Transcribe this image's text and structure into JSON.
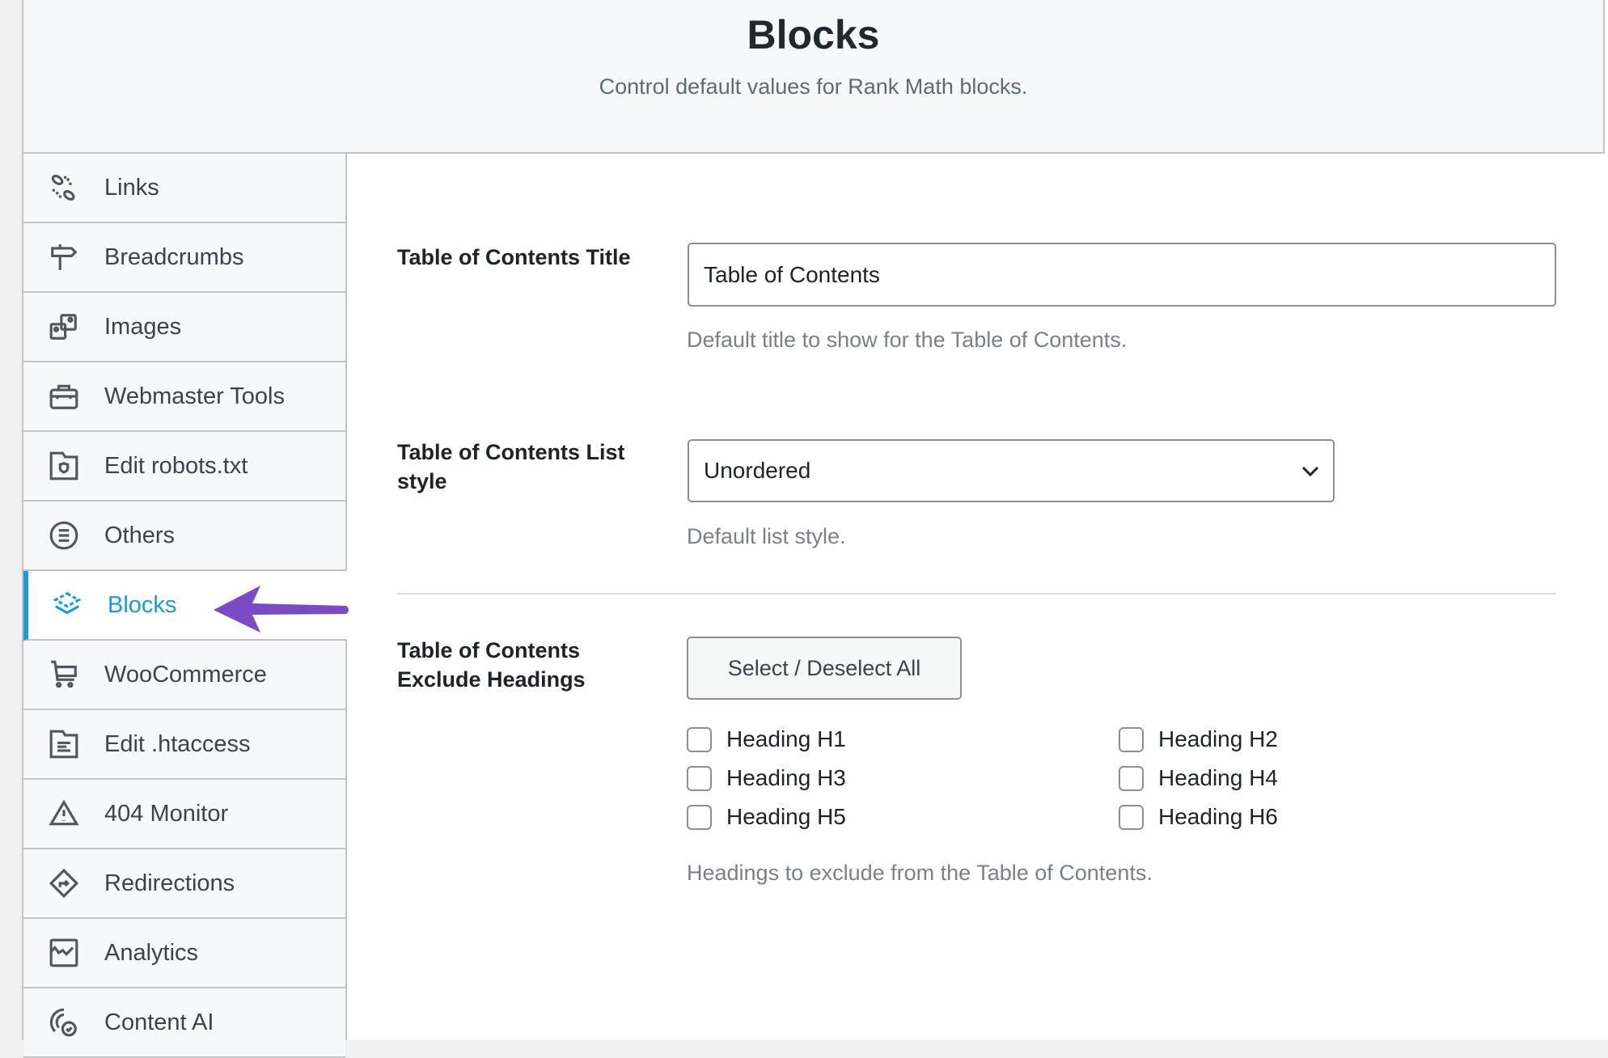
{
  "header": {
    "title": "Blocks",
    "subtitle": "Control default values for Rank Math blocks."
  },
  "sidebar": {
    "items": [
      {
        "label": "Links",
        "icon": "links-icon"
      },
      {
        "label": "Breadcrumbs",
        "icon": "signpost-icon"
      },
      {
        "label": "Images",
        "icon": "images-icon"
      },
      {
        "label": "Webmaster Tools",
        "icon": "toolbox-icon"
      },
      {
        "label": "Edit robots.txt",
        "icon": "folder-shield-icon"
      },
      {
        "label": "Others",
        "icon": "list-circle-icon"
      },
      {
        "label": "Blocks",
        "icon": "blocks-icon",
        "active": true
      },
      {
        "label": "WooCommerce",
        "icon": "cart-icon"
      },
      {
        "label": "Edit .htaccess",
        "icon": "file-text-icon"
      },
      {
        "label": "404 Monitor",
        "icon": "warning-icon"
      },
      {
        "label": "Redirections",
        "icon": "redirect-icon"
      },
      {
        "label": "Analytics",
        "icon": "chart-icon"
      },
      {
        "label": "Content AI",
        "icon": "content-ai-icon"
      }
    ]
  },
  "colors": {
    "accent": "#1a9ad9",
    "annotation_arrow": "#7b4bc4"
  },
  "toc_title": {
    "label": "Table of Contents Title",
    "value": "Table of Contents",
    "hint": "Default title to show for the Table of Contents."
  },
  "toc_list_style": {
    "label": "Table of Contents List style",
    "value": "Unordered",
    "hint": "Default list style."
  },
  "toc_exclude": {
    "label": "Table of Contents Exclude Headings",
    "button": "Select / Deselect All",
    "hint": "Headings to exclude from the Table of Contents.",
    "options": [
      {
        "label": "Heading H1",
        "checked": false
      },
      {
        "label": "Heading H2",
        "checked": false
      },
      {
        "label": "Heading H3",
        "checked": false
      },
      {
        "label": "Heading H4",
        "checked": false
      },
      {
        "label": "Heading H5",
        "checked": false
      },
      {
        "label": "Heading H6",
        "checked": false
      }
    ]
  }
}
